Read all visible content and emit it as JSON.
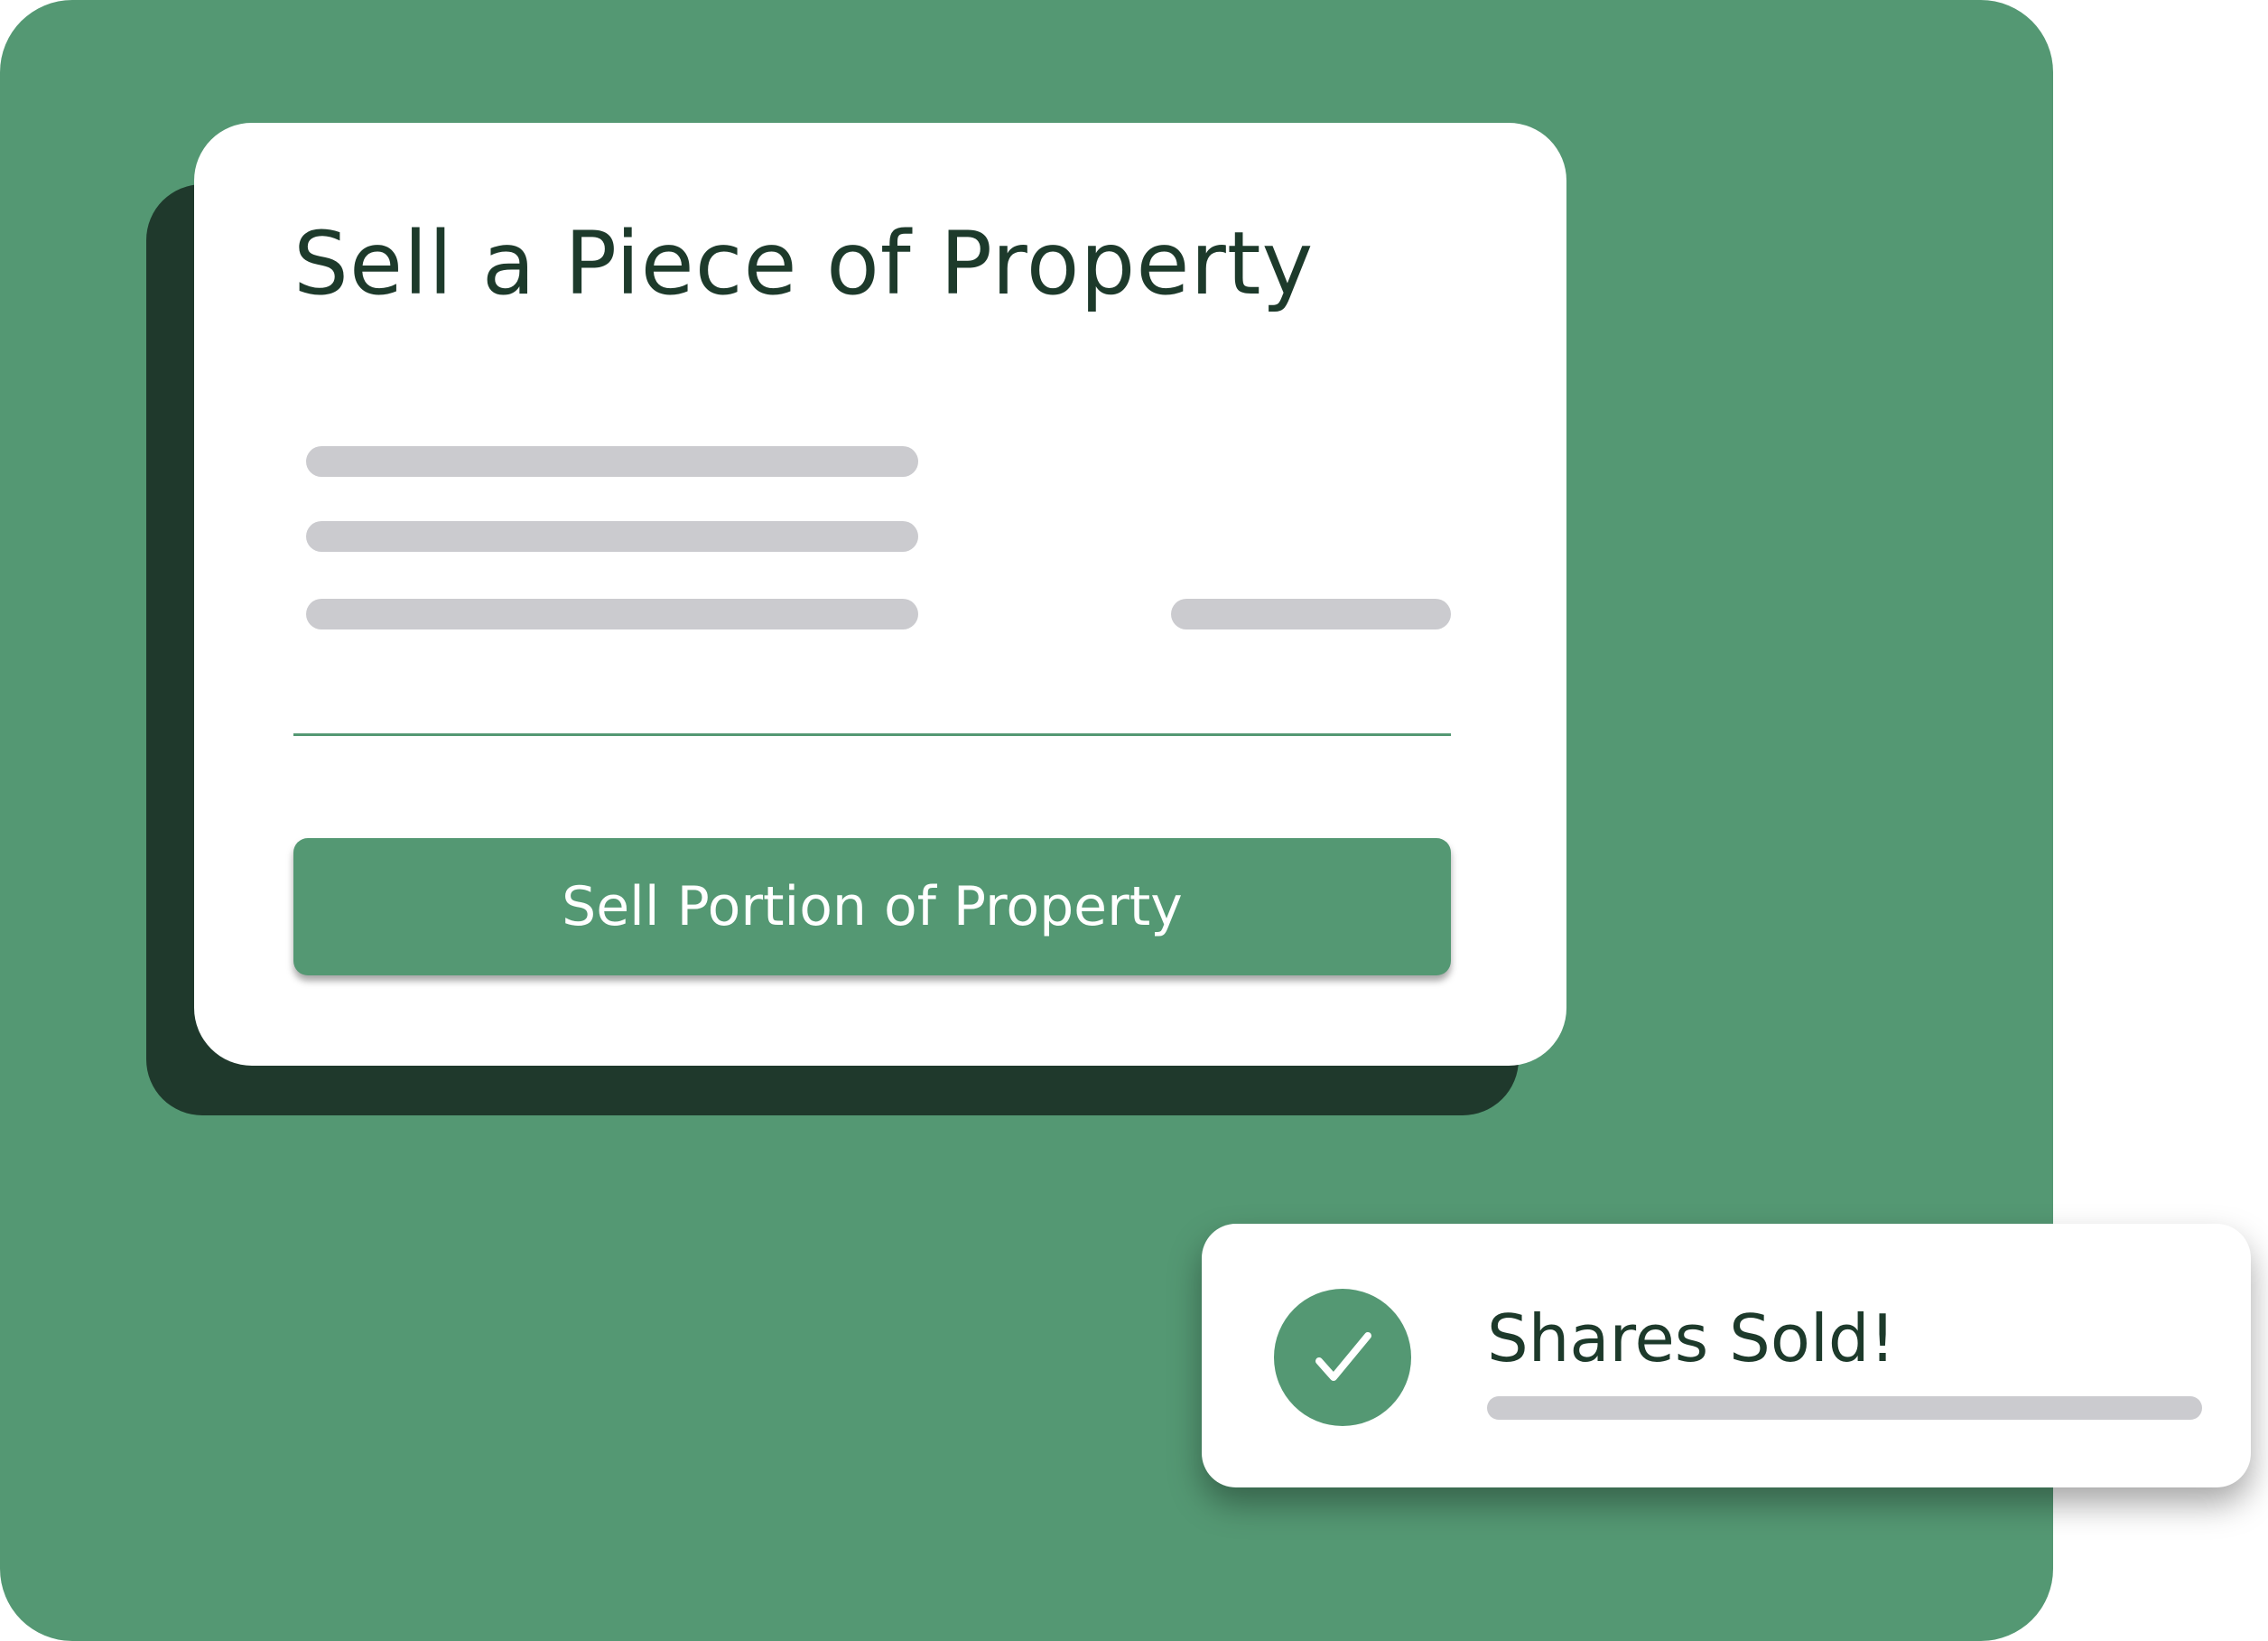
{
  "card": {
    "title": "Sell a Piece of Property",
    "button_label": "Sell Portion of Property"
  },
  "toast": {
    "title": "Shares Sold!",
    "icon": "check-circle-icon"
  },
  "colors": {
    "accent": "#549873",
    "dark": "#1f392c",
    "text": "#1d3a2b",
    "skeleton": "#cbcbcf"
  }
}
